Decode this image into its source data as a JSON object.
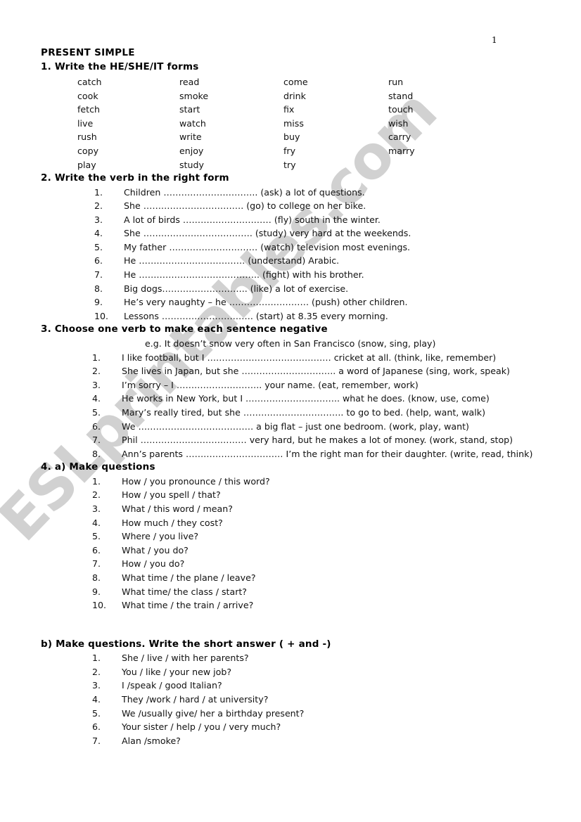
{
  "page": {
    "number": "1",
    "title": "PRESENT SIMPLE",
    "watermark": "ESLprintables.com",
    "watermark_color": "#c9c9c9",
    "background_color": "#ffffff",
    "text_color": "#000000"
  },
  "section1": {
    "heading": "1. Write the HE/SHE/IT forms",
    "columns": [
      [
        "catch",
        "cook",
        "fetch",
        "live",
        "rush",
        "copy",
        "play"
      ],
      [
        "read",
        "smoke",
        "start",
        "watch",
        "write",
        "enjoy",
        "study"
      ],
      [
        "come",
        "drink",
        "fix",
        "miss",
        "buy",
        "fry",
        "try"
      ],
      [
        "run",
        "stand",
        "touch",
        "wish",
        "carry",
        "marry"
      ]
    ]
  },
  "section2": {
    "heading": "2. Write the verb in the right form",
    "items": [
      {
        "num": "1.",
        "text": "Children ………………………….. (ask) a lot of questions."
      },
      {
        "num": "2.",
        "text": "She ……………………………. (go) to college on her bike."
      },
      {
        "num": "3.",
        "text": "A lot of birds ………………………… (fly) south in the winter."
      },
      {
        "num": "4.",
        "text": "She ………………………………. (study) very hard at the weekends."
      },
      {
        "num": "5.",
        "text": "My father ………………………… (watch) television most evenings."
      },
      {
        "num": "6.",
        "text": "He ……………………………… (understand) Arabic."
      },
      {
        "num": "7.",
        "text": "He ………………………………….. (fight) with his brother."
      },
      {
        "num": "8.",
        "text": "Big dogs……………………….. (like) a lot of exercise."
      },
      {
        "num": "9.",
        "text": "He’s very naughty – he ……………………… (push)  other children."
      },
      {
        "num": "10.",
        "text": "Lessons …………………………. (start) at 8.35 every morning."
      }
    ]
  },
  "section3": {
    "heading": "3. Choose one verb to make each sentence negative",
    "example": "e.g. It doesn’t snow very often in San Francisco (snow, sing, play)",
    "items": [
      {
        "num": "1.",
        "text": "I like football, but I …………………………………… cricket at all. (think, like, remember)"
      },
      {
        "num": "2.",
        "text": "She lives in Japan, but she ………………………….. a word of Japanese (sing, work, speak)"
      },
      {
        "num": "3.",
        "text": "I’m sorry – I ……………………….. your name. (eat, remember, work)"
      },
      {
        "num": "4.",
        "text": "He works in New York, but I ………………………….. what he does. (know, use, come)"
      },
      {
        "num": "5.",
        "text": "Mary’s really tired, but she ……………………………. to go to bed. (help, want, walk)"
      },
      {
        "num": "6.",
        "text": "We ………………………………… a big flat – just one bedroom. (work, play, want)"
      },
      {
        "num": "7.",
        "text": "Phil ……………………………… very hard, but he makes a lot of money. (work, stand, stop)"
      },
      {
        "num": "8.",
        "text": "Ann’s parents …………………………… I’m the right man for their daughter. (write, read, think)"
      }
    ]
  },
  "section4a": {
    "heading": "4. a) Make questions",
    "items": [
      {
        "num": "1.",
        "text": "How / you pronounce / this word?"
      },
      {
        "num": "2.",
        "text": "How / you spell / that?"
      },
      {
        "num": "3.",
        "text": "What / this word / mean?"
      },
      {
        "num": "4.",
        "text": "How much / they cost?"
      },
      {
        "num": "5.",
        "text": "Where / you live?"
      },
      {
        "num": "6.",
        "text": "What / you do?"
      },
      {
        "num": "7.",
        "text": "How / you do?"
      },
      {
        "num": "8.",
        "text": "What time / the plane / leave?"
      },
      {
        "num": "9.",
        "text": "What time/ the class / start?"
      },
      {
        "num": "10.",
        "text": "What time / the train / arrive?"
      }
    ]
  },
  "section4b": {
    "heading": "b) Make questions. Write the short answer ( + and -)",
    "items": [
      {
        "num": "1.",
        "text": "She / live / with her parents?"
      },
      {
        "num": "2.",
        "text": "You / like / your new job?"
      },
      {
        "num": "3.",
        "text": "I /speak / good Italian?"
      },
      {
        "num": "4.",
        "text": "They /work / hard / at university?"
      },
      {
        "num": "5.",
        "text": "We /usually give/ her a birthday present?"
      },
      {
        "num": "6.",
        "text": "Your sister / help / you / very much?"
      },
      {
        "num": "7.",
        "text": "Alan /smoke?"
      }
    ]
  }
}
